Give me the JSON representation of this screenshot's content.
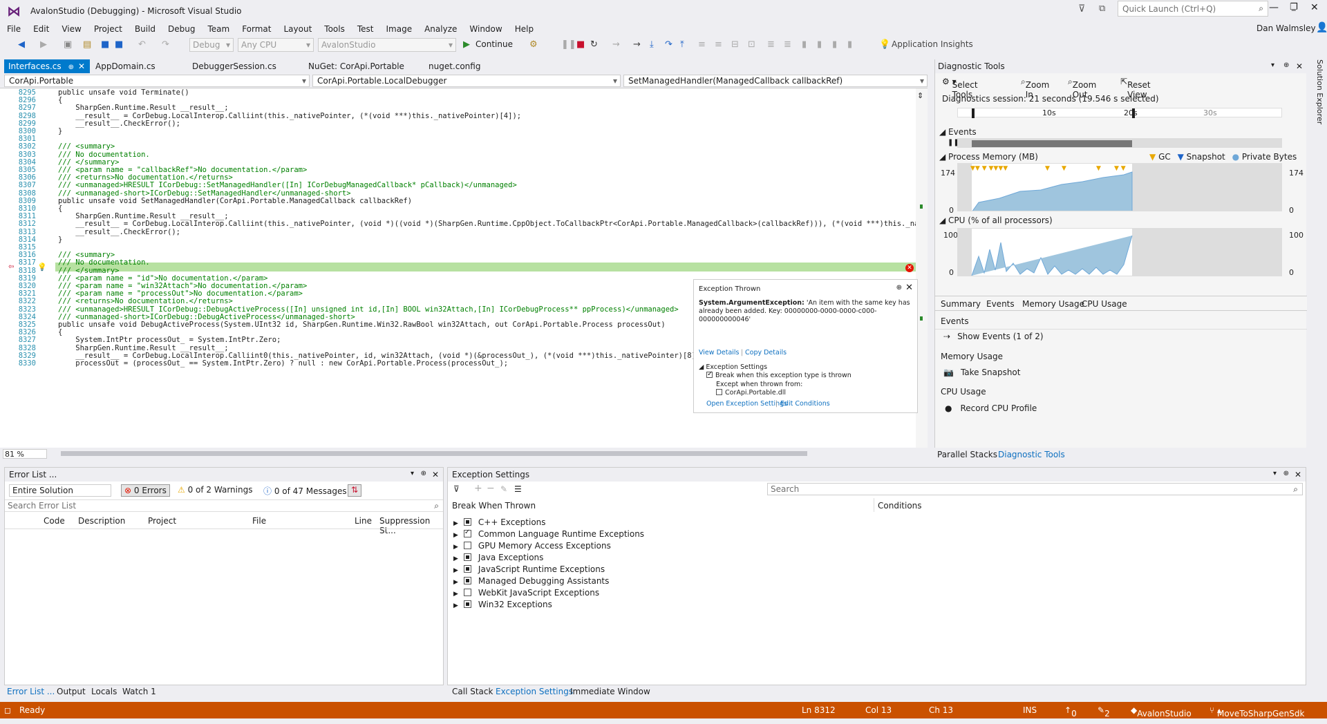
{
  "window": {
    "title": "AvalonStudio (Debugging) - Microsoft Visual Studio",
    "quick_launch": "Quick Launch (Ctrl+Q)",
    "user": "Dan Walmsley"
  },
  "menu": [
    "File",
    "Edit",
    "View",
    "Project",
    "Build",
    "Debug",
    "Team",
    "Format",
    "Layout",
    "Tools",
    "Test",
    "Image",
    "Analyze",
    "Window",
    "Help"
  ],
  "toolbar": {
    "config": "Debug",
    "platform": "Any CPU",
    "project": "AvalonStudio",
    "continue": "Continue",
    "insights": "Application Insights"
  },
  "tabs": [
    "Interfaces.cs",
    "AppDomain.cs",
    "DebuggerSession.cs",
    "NuGet: CorApi.Portable",
    "nuget.config"
  ],
  "nav": {
    "project": "CorApi.Portable",
    "type": "CorApi.Portable.LocalDebugger",
    "member": "SetManagedHandler(ManagedCallback callbackRef)"
  },
  "code": {
    "numbers": [
      "8295",
      "8296",
      "8297",
      "8298",
      "8299",
      "8300",
      "8301",
      "8302",
      "8303",
      "8304",
      "8305",
      "8306",
      "8307",
      "8308",
      "8309",
      "8310",
      "8311",
      "8312",
      "8313",
      "8314",
      "8315",
      "8316",
      "8317",
      "8318",
      "8319",
      "8320",
      "8321",
      "8322",
      "8323",
      "8324",
      "8325",
      "8326",
      "8327",
      "8328",
      "8329",
      "8330"
    ],
    "lines": [
      "public unsafe void Terminate()",
      "{",
      "    SharpGen.Runtime.Result __result__;",
      "    __result__ = CorDebug.LocalInterop.Calliint(this._nativePointer, (*(void ***)this._nativePointer)[4]);",
      "    __result__.CheckError();",
      "}",
      "",
      "/// <summary>",
      "/// No documentation.",
      "/// </summary>",
      "/// <param name = \"callbackRef\">No documentation.</param>",
      "/// <returns>No documentation.</returns>",
      "/// <unmanaged>HRESULT ICorDebug::SetManagedHandler([In] ICorDebugManagedCallback* pCallback)</unmanaged>",
      "/// <unmanaged-short>ICorDebug::SetManagedHandler</unmanaged-short>",
      "public unsafe void SetManagedHandler(CorApi.Portable.ManagedCallback callbackRef)",
      "{",
      "    SharpGen.Runtime.Result __result__;",
      "    __result__ = CorDebug.LocalInterop.Calliint(this._nativePointer, (void *)((void *)(SharpGen.Runtime.CppObject.ToCallbackPtr<CorApi.Portable.ManagedCallback>(callbackRef))), (*(void ***)this._nativePointer)[5]",
      "    __result__.CheckError();",
      "}",
      "",
      "/// <summary>",
      "/// No documentation.",
      "/// </summary>",
      "/// <param name = \"id\">No documentation.</param>",
      "/// <param name = \"win32Attach\">No documentation.</param>",
      "/// <param name = \"processOut\">No documentation.</param>",
      "/// <returns>No documentation.</returns>",
      "/// <unmanaged>HRESULT ICorDebug::DebugActiveProcess([In] unsigned int id,[In] BOOL win32Attach,[In] ICorDebugProcess** ppProcess)</unmanaged>",
      "/// <unmanaged-short>ICorDebug::DebugActiveProcess</unmanaged-short>",
      "public unsafe void DebugActiveProcess(System.UInt32 id, SharpGen.Runtime.Win32.RawBool win32Attach, out CorApi.Portable.Process processOut)",
      "{",
      "    System.IntPtr processOut_ = System.IntPtr.Zero;",
      "    SharpGen.Runtime.Result __result__;",
      "    __result__ = CorDebug.LocalInterop.Calliint0(this._nativePointer, id, win32Attach, (void *)(&processOut_), (*(void ***)this._nativePointer)[8]);",
      "    processOut = (processOut_ == System.IntPtr.Zero) ? null : new CorApi.Portable.Process(processOut_);"
    ]
  },
  "zoom": "81 %",
  "exception_popup": {
    "title": "Exception Thrown",
    "type": "System.ArgumentException:",
    "message": "'An item with the same key has already been added. Key: 00000000-0000-0000-c000-000000000046'",
    "view_details": "View Details",
    "copy_details": "Copy Details",
    "settings_header": "Exception Settings",
    "break_label": "Break when this exception type is thrown",
    "except_label": "Except when thrown from:",
    "module": "CorApi.Portable.dll",
    "open_settings": "Open Exception Settings",
    "edit_conditions": "Edit Conditions"
  },
  "diagnostics": {
    "title": "Diagnostic Tools",
    "select_tools": "Select Tools",
    "zoom_in": "Zoom In",
    "zoom_out": "Zoom Out",
    "reset": "Reset View",
    "session": "Diagnostics session: 21 seconds (19.546 s selected)",
    "ticks": [
      "10s",
      "20s",
      "30s"
    ],
    "events": "Events",
    "memory": "Process Memory (MB)",
    "gc": "GC",
    "snapshot": "Snapshot",
    "private": "Private Bytes",
    "mem_max": "174",
    "mem_min": "0",
    "cpu": "CPU (% of all processors)",
    "cpu_max": "100",
    "cpu_min": "0",
    "tabs": [
      "Summary",
      "Events",
      "Memory Usage",
      "CPU Usage"
    ],
    "sec_events": "Events",
    "show_events": "Show Events (1 of 2)",
    "sec_memory": "Memory Usage",
    "take_snapshot": "Take Snapshot",
    "sec_cpu": "CPU Usage",
    "record_cpu": "Record CPU Profile",
    "bottom_tabs": [
      "Parallel Stacks",
      "Diagnostic Tools"
    ]
  },
  "error_list": {
    "title": "Error List ...",
    "scope": "Entire Solution",
    "errors": "0 Errors",
    "warnings": "0 of 2 Warnings",
    "messages": "0 of 47 Messages",
    "search": "Search Error List",
    "columns": [
      "Code",
      "Description",
      "Project",
      "File",
      "Line",
      "Suppression St..."
    ],
    "bottom_tabs": [
      "Error List ...",
      "Output",
      "Locals",
      "Watch 1"
    ]
  },
  "exception_settings": {
    "title": "Exception Settings",
    "search": "Search",
    "col_break": "Break When Thrown",
    "col_conditions": "Conditions",
    "items": [
      "C++ Exceptions",
      "Common Language Runtime Exceptions",
      "GPU Memory Access Exceptions",
      "Java Exceptions",
      "JavaScript Runtime Exceptions",
      "Managed Debugging Assistants",
      "WebKit JavaScript Exceptions",
      "Win32 Exceptions"
    ],
    "bottom_tabs": [
      "Call Stack",
      "Exception Settings",
      "Immediate Window"
    ]
  },
  "status": {
    "ready": "Ready",
    "ln": "Ln 8312",
    "col": "Col 13",
    "ch": "Ch 13",
    "ins": "INS",
    "up": "0",
    "edits": "2",
    "repo": "AvalonStudio",
    "branch": "MoveToSharpGenSdk"
  },
  "colors": {
    "accent": "#007acc",
    "status": "#ca5100",
    "highlight": "#b7e1a1",
    "chart": "#9fc5de"
  }
}
